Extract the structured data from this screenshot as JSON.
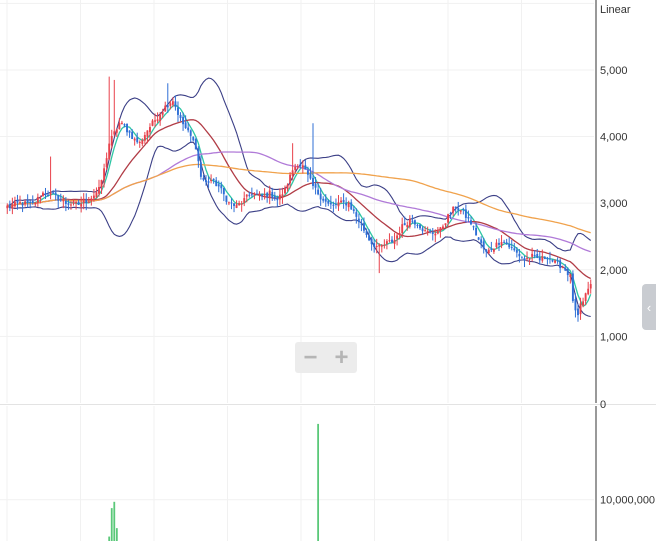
{
  "scale_label": "Linear",
  "zoom": {
    "minus": "−",
    "plus": "+"
  },
  "side_tab_glyph": "‹",
  "colors": {
    "up": "#e8414b",
    "down": "#2f6fd6",
    "volume": "#5ac879",
    "ma_short": "#2ec6a4",
    "ma_mid": "#b13c46",
    "ma_long": "#b07ad8",
    "ma_longest": "#f0a24c",
    "bollinger": "#3b3f86",
    "grid": "#f1f1f1",
    "axis": "#333333",
    "text": "#333333",
    "zoom_bg": "#ececec",
    "tab_bg": "#c9ccd1"
  },
  "icons": {
    "zoom_out": "minus-icon",
    "zoom_in": "plus-icon",
    "side_tab": "chevron-left-icon"
  },
  "chart_data": [
    {
      "type": "candlestick",
      "scale": "linear",
      "title": "",
      "x_count": 230,
      "ylim": [
        0,
        6050
      ],
      "yticks": [
        {
          "value": 1000,
          "label": "1,000"
        },
        {
          "value": 2000,
          "label": "2,000"
        },
        {
          "value": 3000,
          "label": "3,000"
        },
        {
          "value": 4000,
          "label": "4,000"
        },
        {
          "value": 5000,
          "label": "5,000"
        }
      ],
      "zero_label": "0",
      "grid": true,
      "close_anchors": [
        [
          0,
          2950
        ],
        [
          5,
          3000
        ],
        [
          10,
          2980
        ],
        [
          14,
          3150
        ],
        [
          18,
          3120
        ],
        [
          23,
          3000
        ],
        [
          28,
          2980
        ],
        [
          32,
          3050
        ],
        [
          36,
          3200
        ],
        [
          38,
          3500
        ],
        [
          40,
          3900
        ],
        [
          42,
          4050
        ],
        [
          44,
          4200
        ],
        [
          46,
          4150
        ],
        [
          48,
          4050
        ],
        [
          50,
          3950
        ],
        [
          52,
          3900
        ],
        [
          55,
          4100
        ],
        [
          58,
          4250
        ],
        [
          62,
          4450
        ],
        [
          65,
          4550
        ],
        [
          68,
          4250
        ],
        [
          72,
          4000
        ],
        [
          74,
          3850
        ],
        [
          76,
          3400
        ],
        [
          78,
          3300
        ],
        [
          80,
          3350
        ],
        [
          83,
          3250
        ],
        [
          87,
          3000
        ],
        [
          90,
          2950
        ],
        [
          93,
          3050
        ],
        [
          96,
          3150
        ],
        [
          100,
          3100
        ],
        [
          103,
          3150
        ],
        [
          106,
          3050
        ],
        [
          109,
          3200
        ],
        [
          112,
          3500
        ],
        [
          114,
          3600
        ],
        [
          116,
          3550
        ],
        [
          118,
          3400
        ],
        [
          120,
          3250
        ],
        [
          123,
          3100
        ],
        [
          126,
          2980
        ],
        [
          128,
          2950
        ],
        [
          130,
          3000
        ],
        [
          134,
          3000
        ],
        [
          137,
          2800
        ],
        [
          140,
          2600
        ],
        [
          143,
          2400
        ],
        [
          146,
          2330
        ],
        [
          149,
          2400
        ],
        [
          152,
          2450
        ],
        [
          155,
          2650
        ],
        [
          158,
          2750
        ],
        [
          161,
          2700
        ],
        [
          164,
          2570
        ],
        [
          167,
          2550
        ],
        [
          170,
          2600
        ],
        [
          173,
          2800
        ],
        [
          176,
          2950
        ],
        [
          179,
          2850
        ],
        [
          182,
          2700
        ],
        [
          185,
          2450
        ],
        [
          188,
          2250
        ],
        [
          191,
          2350
        ],
        [
          194,
          2450
        ],
        [
          197,
          2350
        ],
        [
          200,
          2250
        ],
        [
          203,
          2150
        ],
        [
          206,
          2200
        ],
        [
          209,
          2150
        ],
        [
          212,
          2200
        ],
        [
          215,
          2100
        ],
        [
          218,
          2050
        ],
        [
          221,
          1900
        ],
        [
          222,
          1550
        ],
        [
          223,
          1350
        ],
        [
          224,
          1300
        ],
        [
          225,
          1450
        ],
        [
          226,
          1500
        ],
        [
          227,
          1650
        ],
        [
          229,
          1750
        ]
      ],
      "spikes": [
        [
          40,
          4900
        ],
        [
          42,
          4850
        ],
        [
          63,
          4800
        ],
        [
          112,
          3900
        ],
        [
          120,
          4200
        ],
        [
          17,
          3700
        ],
        [
          146,
          1950
        ]
      ],
      "moving_averages": [
        {
          "key": "ma_short",
          "period": 5
        },
        {
          "key": "ma_mid",
          "period": 20
        },
        {
          "key": "ma_long",
          "period": 60
        },
        {
          "key": "ma_longest",
          "period": 120
        }
      ],
      "bollinger": {
        "period": 20,
        "k": 2
      }
    },
    {
      "type": "bar",
      "title": "",
      "name": "volume",
      "yticks": [
        {
          "value": 10000000,
          "label": "10,000,000"
        }
      ],
      "ymax": 17000000,
      "grid": true,
      "values_sparse": [
        [
          0,
          900000
        ],
        [
          5,
          1100000
        ],
        [
          9,
          800000
        ],
        [
          14,
          1300000
        ],
        [
          18,
          700000
        ],
        [
          23,
          1000000
        ],
        [
          28,
          900000
        ],
        [
          33,
          1200000
        ],
        [
          39,
          4100000
        ],
        [
          40,
          6500000
        ],
        [
          41,
          9200000
        ],
        [
          42,
          9800000
        ],
        [
          43,
          7300000
        ],
        [
          44,
          2500000
        ],
        [
          48,
          1900000
        ],
        [
          55,
          1700000
        ],
        [
          62,
          2300000
        ],
        [
          70,
          1500000
        ],
        [
          80,
          1200000
        ],
        [
          90,
          1000000
        ],
        [
          100,
          1300000
        ],
        [
          108,
          900000
        ],
        [
          111,
          1400000
        ],
        [
          112,
          2500000
        ],
        [
          113,
          4900000
        ],
        [
          114,
          2300000
        ],
        [
          117,
          1800000
        ],
        [
          121,
          2600000
        ],
        [
          122,
          17200000
        ],
        [
          123,
          3600000
        ],
        [
          124,
          2100000
        ],
        [
          130,
          1100000
        ],
        [
          140,
          1400000
        ],
        [
          150,
          1000000
        ],
        [
          160,
          900000
        ],
        [
          170,
          1200000
        ],
        [
          180,
          1000000
        ],
        [
          190,
          900000
        ],
        [
          200,
          800000
        ],
        [
          210,
          900000
        ],
        [
          220,
          1100000
        ],
        [
          223,
          1600000
        ],
        [
          226,
          1300000
        ]
      ]
    }
  ]
}
